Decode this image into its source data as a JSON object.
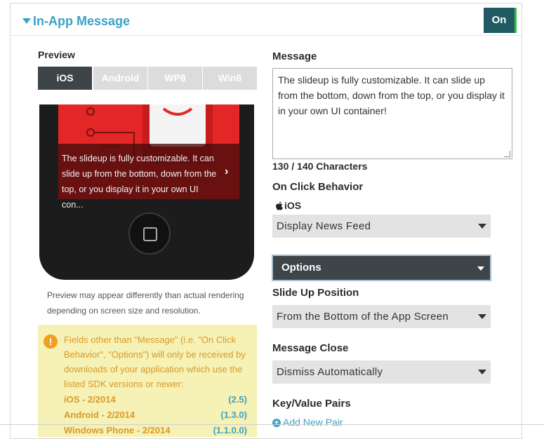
{
  "header": {
    "title": "In-App Message",
    "toggle_label": "On"
  },
  "preview": {
    "label": "Preview",
    "tabs": [
      {
        "label": "iOS",
        "active": true
      },
      {
        "label": "Android",
        "active": false
      },
      {
        "label": "WP8",
        "active": false
      },
      {
        "label": "Win8",
        "active": false
      }
    ],
    "slideup_text": "The slideup is fully customizable. It can slide up from the bottom, down from the top, or you display it in your own UI con...",
    "note": "Preview may appear differently than actual rendering depending on screen size and resolution."
  },
  "warning": {
    "text": "Fields other than \"Message\" (i.e. \"On Click Behavior\", \"Options\") will only be received by downloads of your application which use the listed SDK versions or newer:",
    "versions": [
      {
        "platform": "iOS - 2/2014",
        "version": "(2.5)"
      },
      {
        "platform": "Android - 2/2014",
        "version": "(1.3.0)"
      },
      {
        "platform": "Windows Phone - 2/2014",
        "version": "(1.1.0.0)"
      }
    ]
  },
  "message": {
    "label": "Message",
    "value": "The slideup is fully customizable. It can slide up from the bottom, down from the top, or you display it in your own UI container!",
    "char_count": "130 / 140 Characters"
  },
  "on_click": {
    "label": "On Click Behavior",
    "platform": "iOS",
    "selected": "Display News Feed"
  },
  "options": {
    "label": "Options"
  },
  "slide_up": {
    "label": "Slide Up Position",
    "selected": "From the Bottom of the App Screen"
  },
  "message_close": {
    "label": "Message Close",
    "selected": "Dismiss Automatically"
  },
  "kv_pairs": {
    "label": "Key/Value Pairs",
    "add_label": "Add New Pair"
  },
  "colors": {
    "accent": "#3aa3c6",
    "toggle_bg": "#205a63",
    "dark_button": "#3e4549",
    "warning_bg": "#f6f1b4",
    "warning_text": "#d99a2b"
  }
}
